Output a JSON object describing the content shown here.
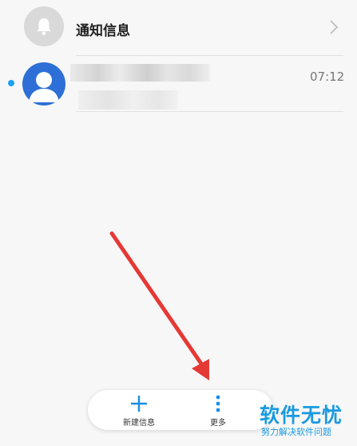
{
  "conversations": [
    {
      "title": "通知信息"
    },
    {
      "time": "07:12",
      "unread": true
    }
  ],
  "bottom_bar": {
    "new_message_label": "新建信息",
    "more_label": "更多"
  },
  "watermark": {
    "title": "软件无忧",
    "subtitle": "努力解决软件问题"
  },
  "colors": {
    "accent": "#1a9ae0",
    "unread_dot": "#1ea0f0",
    "avatar": "#2d6fd6",
    "arrow": "#e53935"
  }
}
